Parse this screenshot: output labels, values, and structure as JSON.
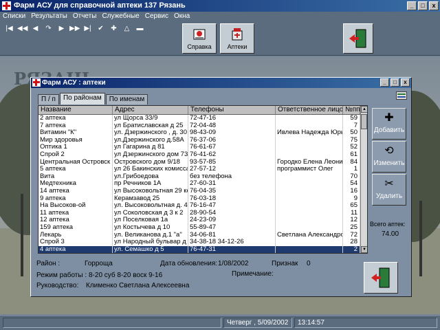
{
  "window": {
    "title": "Фарм АСУ для справочной аптеки 137 Рязань",
    "min": "_",
    "max": "□",
    "close": "x"
  },
  "menu": [
    "Списки",
    "Результаты",
    "Отчеты",
    "Служебные",
    "Сервис",
    "Окна"
  ],
  "nav_icons": [
    "first-icon",
    "prev-page-icon",
    "prev-icon",
    "refresh-icon",
    "next-icon",
    "next-page-icon",
    "last-icon",
    "check-icon",
    "plus-icon",
    "triangle-icon",
    "minus-icon"
  ],
  "toolbar": {
    "help_label": "Справка",
    "pharmacies_label": "Аптеки"
  },
  "background_text": "РЯЗАНЬ",
  "child": {
    "title": "Фарм АСУ : аптеки",
    "tabs": [
      "П / п",
      "По районам",
      "По именам"
    ],
    "active_tab": 1
  },
  "grid": {
    "headers": [
      "Название",
      "Адрес",
      "Телефоны",
      "Ответственное лицо",
      "№пп"
    ],
    "rows": [
      [
        "2 аптека",
        "ул Щорса 33/9",
        "72-47-16",
        "",
        "59"
      ],
      [
        "7 аптека",
        "ул Братиславская д 25",
        "72-04-48",
        "",
        "7"
      ],
      [
        "Витамин \"К\"",
        "ул. Дзержинского , д. 30",
        "98-43-09",
        "Ивлева Надежда Юрьев",
        "50"
      ],
      [
        "Мир здоровья",
        "ул.Дзержинского д.58А",
        "76-37-06",
        "",
        "75"
      ],
      [
        "Оптика 1",
        "ул Гагарина д 81",
        "76-61-67",
        "",
        "52"
      ],
      [
        "Спрой 2",
        "ул Дзержинского дом 73",
        "76-41-62",
        "",
        "61"
      ],
      [
        "Центральная Островск",
        "Островского дом 9/18",
        "93-57-85",
        "Городко Елена Леонид",
        "84"
      ],
      [
        "5 аптека",
        "ул 26 Бакинских комисса",
        "27-57-12",
        "программист Олег",
        "1"
      ],
      [
        "Вита",
        "ул.Грибоедова",
        "без телефона",
        "",
        "70"
      ],
      [
        "Медтехника",
        "пр Речников 1А",
        "27-60-31",
        "",
        "54"
      ],
      [
        "14 аптека",
        "ул Высоковольтная 29 ко",
        "76-04-35",
        "",
        "16"
      ],
      [
        "9 аптека",
        "Керамзавод 25",
        "76-03-18",
        "",
        "9"
      ],
      [
        "На Высоков-ой",
        "ул. Высоковольтная д. 40",
        "76-16-47",
        "",
        "65"
      ],
      [
        "11 аптека",
        "ул Соколовская д 3 к 2",
        "28-90-54",
        "",
        "11"
      ],
      [
        "12 аптека",
        "ул Поселковая 1а",
        "24-23-09",
        "",
        "12"
      ],
      [
        "159 аптека",
        "ул Костычева д 10",
        "55-89-47",
        "",
        "25"
      ],
      [
        "Лекарь",
        "ул. Великанова д.1 \"а\"",
        "34-06-81",
        "Светлана Александро",
        "72"
      ],
      [
        "Спрой 3",
        "ул Народный бульвар д 8",
        "34-38-18   34-12-26",
        "",
        "28"
      ],
      [
        "4 аптека",
        "ул. Семашко д 5",
        "76-47-31",
        "",
        "2"
      ]
    ],
    "selected_row": 18
  },
  "actions": {
    "add": "Добавить",
    "edit": "Изменить",
    "delete": "Удалить"
  },
  "totals": {
    "label": "Всего аптек:",
    "value": "74.00"
  },
  "details": {
    "district_label": "Район :",
    "district": "Горроща",
    "updated_label": "Дата обновления:",
    "updated": "1/08/2002",
    "flag_label": "Признак",
    "flag": "0",
    "hours_label": "Режим работы :",
    "hours": "8-20  суб 8-20  воск 9-16",
    "note_label": "Примечание:",
    "manager_label": "Руководство:",
    "manager": "Клименко Светлана Алексеевна"
  },
  "status": {
    "date": "Четверг ,  5/09/2002",
    "time": "13:14:57"
  }
}
